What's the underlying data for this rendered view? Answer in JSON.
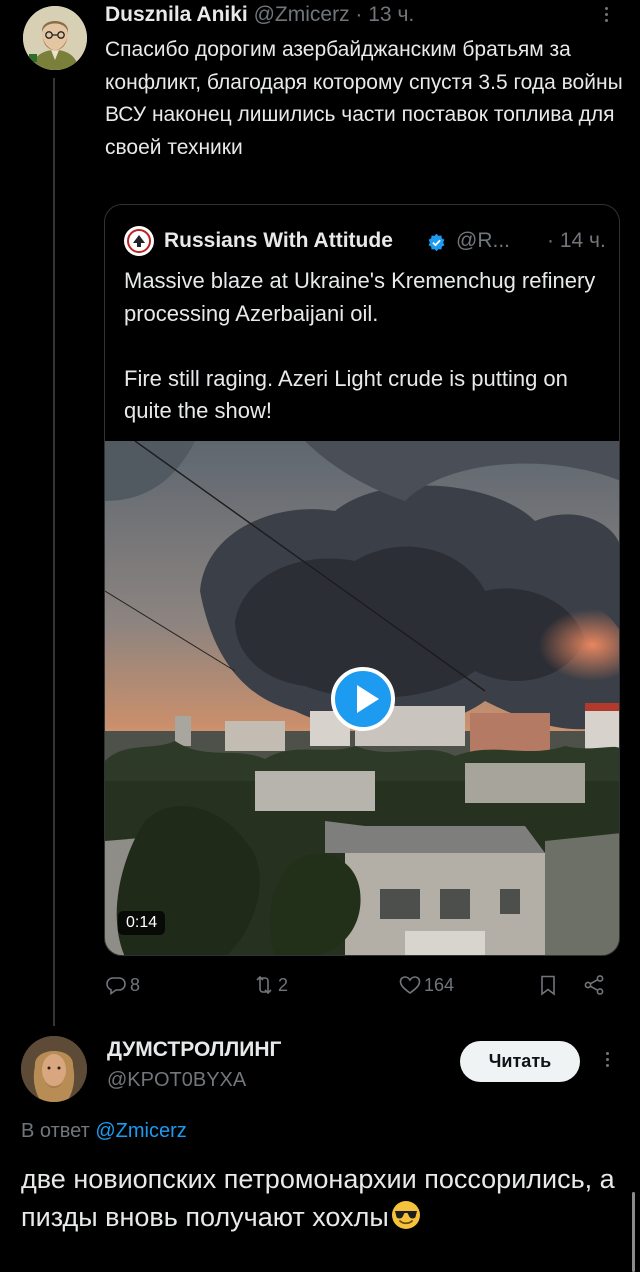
{
  "tweet": {
    "author_name": "Dusznila Aniki",
    "handle": "@Zmicerz",
    "separator": " · ",
    "time": "13 ч.",
    "text": "Спасибо дорогим азербайджанским братьям за конфликт, благодаря которому спустя 3.5 года войны ВСУ наконец лишились части поставок топлива для своей техники",
    "quoted": {
      "author_name": "Russians With Attitude",
      "handle": "@R...",
      "separator": " · ",
      "time": "14 ч.",
      "text": "Massive blaze at Ukraine's Kremenchug refinery processing Azerbaijani oil.\n\nFire still raging. Azeri Light crude is putting on quite the show!",
      "video_duration": "0:14"
    },
    "actions": {
      "replies": "8",
      "reposts": "2",
      "likes": "164"
    }
  },
  "reply": {
    "author_name": "ДУМСТРОЛЛИНГ",
    "handle": "@KPOT0BYXA",
    "follow_label": "Читать",
    "reply_prefix": "В ответ ",
    "reply_mention": "@Zmicerz",
    "text": "две новиопских петромонархии поссорились, а пизды вновь получают хохлы"
  },
  "colors": {
    "accent": "#1d9bf0",
    "muted": "#71767b",
    "text": "#e7e9ea",
    "background": "#000000"
  }
}
